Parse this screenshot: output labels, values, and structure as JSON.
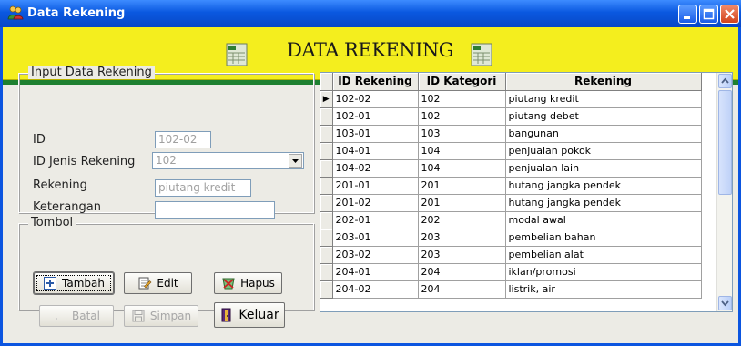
{
  "window": {
    "title": "Data Rekening"
  },
  "banner": {
    "title": "DATA REKENING"
  },
  "input_group": {
    "label": "Input Data Rekening",
    "fields": {
      "id_label": "ID",
      "id_value": "102-02",
      "jenis_label": "ID Jenis Rekening",
      "jenis_value": "102",
      "rekening_label": "Rekening",
      "rekening_value": "piutang kredit",
      "keterangan_label": "Keterangan",
      "keterangan_value": ""
    }
  },
  "tombol_group": {
    "label": "Tombol",
    "buttons": {
      "tambah": "Tambah",
      "edit": "Edit",
      "hapus": "Hapus",
      "batal": "Batal",
      "simpan": "Simpan",
      "keluar": "Keluar"
    }
  },
  "grid": {
    "columns": [
      "ID Rekening",
      "ID Kategori",
      "Rekening"
    ],
    "current_row_marker": "▶",
    "rows": [
      [
        "102-02",
        "102",
        "piutang kredit"
      ],
      [
        "102-01",
        "102",
        "piutang debet"
      ],
      [
        "103-01",
        "103",
        "bangunan"
      ],
      [
        "104-01",
        "104",
        "penjualan pokok"
      ],
      [
        "104-02",
        "104",
        "penjualan lain"
      ],
      [
        "201-01",
        "201",
        "hutang jangka pendek"
      ],
      [
        "201-02",
        "201",
        "hutang jangka pendek"
      ],
      [
        "202-01",
        "202",
        "modal awal"
      ],
      [
        "203-01",
        "203",
        "pembelian bahan"
      ],
      [
        "203-02",
        "203",
        "pembelian alat"
      ],
      [
        "204-01",
        "204",
        "iklan/promosi"
      ],
      [
        "204-02",
        "204",
        "listrik, air"
      ]
    ]
  },
  "colors": {
    "titlebar": "#0a58e0",
    "banner": "#f4ee1e",
    "banner_separator": "#1e8030",
    "panel": "#ecebe5"
  }
}
